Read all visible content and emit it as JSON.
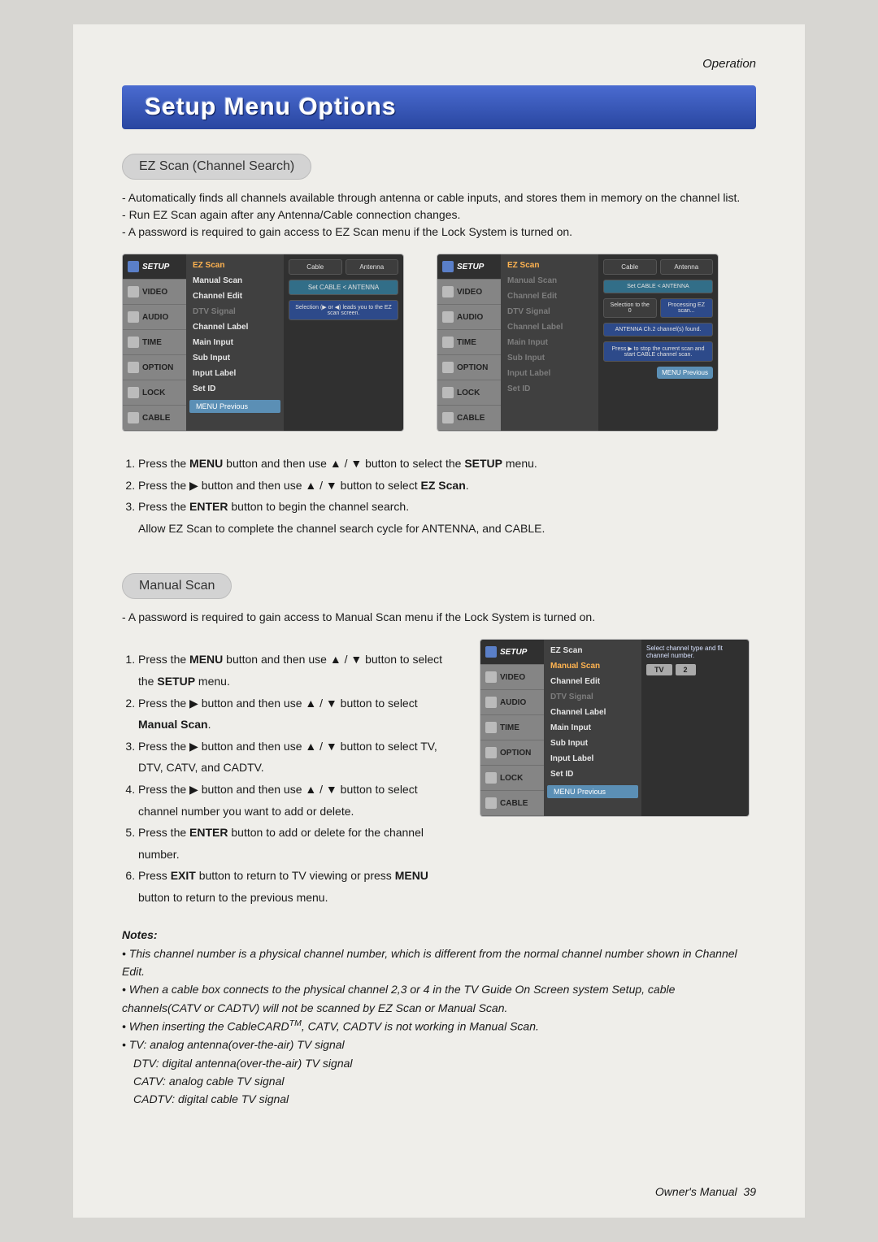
{
  "header": {
    "section": "Operation"
  },
  "title": "Setup Menu Options",
  "ezscan": {
    "heading": "EZ Scan (Channel Search)",
    "bullets": [
      "Automatically finds all channels available through antenna or cable inputs, and stores them in memory on the channel list.",
      "Run EZ Scan again after any Antenna/Cable connection changes.",
      "A password is required to gain access to EZ Scan menu if the Lock System is turned on."
    ],
    "steps": {
      "s1a": "Press the ",
      "s1b": "MENU",
      "s1c": " button and then use ",
      "s1d": " button to select the ",
      "s1e": "SETUP",
      "s1f": " menu.",
      "s2a": "Press the ",
      "s2b": " button and then use ",
      "s2c": " button to select ",
      "s2d": "EZ Scan",
      "s2e": ".",
      "s3a": "Press the ",
      "s3b": "ENTER",
      "s3c": " button to begin the channel search.",
      "s3sub": "Allow EZ Scan to complete the channel search cycle for ANTENNA, and CABLE."
    }
  },
  "manual": {
    "heading": "Manual Scan",
    "bullets": [
      "A password is required to gain access to Manual Scan menu if the Lock System is turned on."
    ],
    "steps": {
      "s1a": "Press the ",
      "s1b": "MENU",
      "s1c": " button and then use ",
      "s1d": " button to select the ",
      "s1e": "SETUP",
      "s1f": " menu.",
      "s2a": "Press the ",
      "s2b": " button and then use ",
      "s2c": " button to select ",
      "s2d": "Manual Scan",
      "s2e": ".",
      "s3a": "Press the ",
      "s3b": " button and then use ",
      "s3c": " button to select TV, DTV, CATV, and CADTV.",
      "s4a": "Press the ",
      "s4b": " button and then use ",
      "s4c": " button to select channel number you want to add or delete.",
      "s5a": "Press the ",
      "s5b": "ENTER",
      "s5c": " button to add or delete for the channel number.",
      "s6a": "Press ",
      "s6b": "EXIT",
      "s6c": " button to return to TV viewing or press ",
      "s6d": "MENU",
      "s6e": " button to return to the previous menu."
    }
  },
  "menu": {
    "tabs": [
      "SETUP",
      "VIDEO",
      "AUDIO",
      "TIME",
      "OPTION",
      "LOCK",
      "CABLE"
    ],
    "items": [
      "EZ Scan",
      "Manual Scan",
      "Channel Edit",
      "DTV Signal",
      "Channel Label",
      "Main Input",
      "Sub Input",
      "Input Label",
      "Set ID"
    ],
    "prev": "MENU Previous",
    "fig1_right": {
      "top_left": "Cable",
      "top_right": "Antenna",
      "mid": "Set CABLE < ANTENNA",
      "hint": "Selection (▶ or ◀) leads you to the EZ scan screen."
    },
    "fig2_right": {
      "top_left": "Cable",
      "top_right": "Antenna",
      "cab": "Set CABLE < ANTENNA",
      "proc": "Processing EZ scan...",
      "sel": "Selection to the 0",
      "ant": "ANTENNA Ch.2 channel(s) found.",
      "press": "Press ▶ to stop the current scan and start CABLE channel scan.",
      "prev": "MENU Previous"
    },
    "fig3_right": {
      "sel": "Select channel type and fit channel number.",
      "tv": "TV",
      "ch": "2"
    }
  },
  "notes": {
    "title": "Notes:",
    "n1": "• This channel number is a physical channel number, which is different from the normal channel number shown in Channel Edit.",
    "n2": "• When a cable box connects to the physical channel 2,3 or 4 in the TV Guide On Screen system Setup, cable channels(CATV or CADTV) will not be scanned by EZ Scan or Manual Scan.",
    "n3a": "• When inserting the CableCARD",
    "n3b": ", CATV, CADTV is not working in Manual Scan.",
    "n4": "•  TV: analog antenna(over-the-air) TV signal",
    "n5": "DTV: digital antenna(over-the-air) TV signal",
    "n6": "CATV: analog cable TV signal",
    "n7": "CADTV: digital cable TV signal"
  },
  "footer": {
    "label": "Owner's Manual",
    "page": "39"
  },
  "glyph": {
    "up": "▲",
    "down": "▼",
    "right": "▶",
    "sep": " / ",
    "tm": "TM"
  }
}
